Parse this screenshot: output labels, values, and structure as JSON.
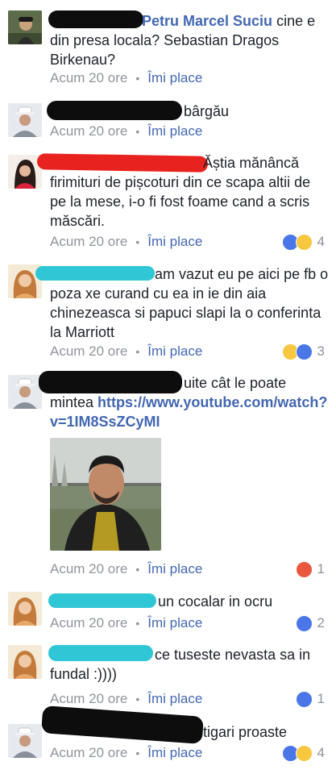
{
  "comments": [
    {
      "id": "c1",
      "author": "Petru Marcel Suciu",
      "text": " cine e din presa locala? Sebastian Dragos Birkenau?",
      "time": "Acum 20 ore",
      "like": "Îmi place"
    },
    {
      "id": "c2",
      "text": "bârgău",
      "time": "Acum 20 ore",
      "like": "Îmi place"
    },
    {
      "id": "c3",
      "text": "Ăștia mănâncă firimituri de pișcoturi din ce scapa altii de pe la mese, i-o fi fost foame cand a scris măscări.",
      "time": "Acum 20 ore",
      "like": "Îmi place",
      "reactions": [
        "like",
        "haha"
      ],
      "count": "4"
    },
    {
      "id": "c4",
      "text": "am vazut eu pe aici pe fb o poza xe curand cu ea in ie din aia chinezeasca si papuci slapi  la o conferinta  la Marriott",
      "time": "Acum 20 ore",
      "like": "Îmi place",
      "reactions": [
        "haha",
        "like"
      ],
      "count": "3"
    },
    {
      "id": "c5",
      "text": "uite cât le poate mintea ",
      "link": "https://www.youtube.com/watch?v=1IM8SsZCyMI",
      "time": "Acum 20 ore",
      "like": "Îmi place",
      "reactions": [
        "angry"
      ],
      "count": "1"
    },
    {
      "id": "c6",
      "text": "un cocalar in ocru",
      "time": "Acum 20 ore",
      "like": "Îmi place",
      "reactions": [
        "like"
      ],
      "count": "2"
    },
    {
      "id": "c7",
      "text": "ce tuseste  nevasta  sa in fundal  :))))",
      "time": "Acum 20 ore",
      "like": "Îmi place",
      "reactions": [
        "like"
      ],
      "count": "1"
    },
    {
      "id": "c8",
      "text": "tigari proaste",
      "time": "Acum 20 ore",
      "like": "Îmi place",
      "reactions": [
        "like",
        "haha"
      ],
      "count": "4"
    }
  ],
  "colors": {
    "link": "#4267b2",
    "meta": "#90949c",
    "text": "#1d2129",
    "like_icon": "#4a76e8",
    "haha_icon": "#f7c73f",
    "angry_icon": "#e9573f",
    "redact_black": "#0d0d0d",
    "redact_red": "#e8231f",
    "redact_cyan": "#2fc7d6"
  }
}
